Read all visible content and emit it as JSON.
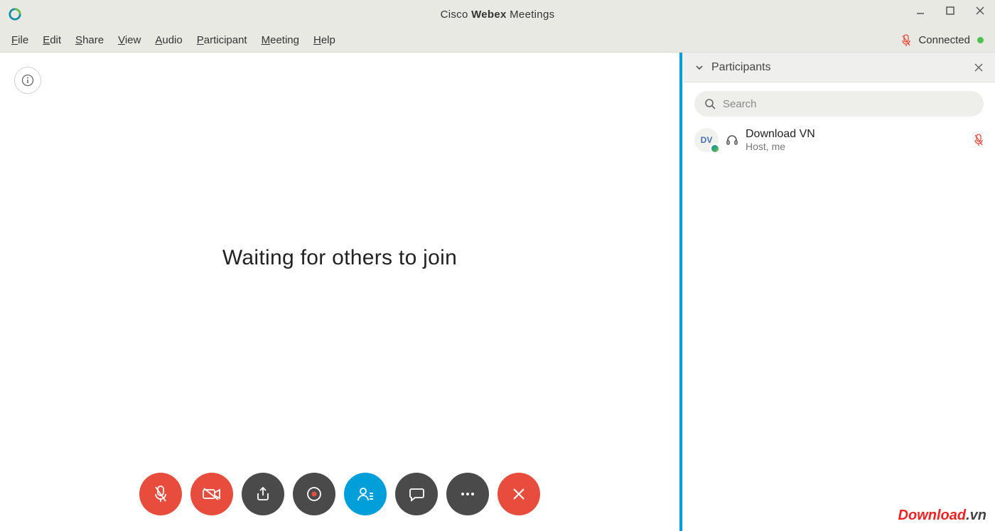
{
  "window": {
    "title_prefix": "Cisco ",
    "title_bold": "Webex",
    "title_suffix": " Meetings"
  },
  "menu": {
    "file": "File",
    "edit": "Edit",
    "share": "Share",
    "view": "View",
    "audio": "Audio",
    "participant": "Participant",
    "meeting": "Meeting",
    "help": "Help"
  },
  "status": {
    "connected_label": "Connected"
  },
  "stage": {
    "waiting_text": "Waiting for others to join"
  },
  "panel": {
    "title": "Participants",
    "search_placeholder": "Search"
  },
  "participants": [
    {
      "initials": "DV",
      "name": "Download VN",
      "role": "Host, me"
    }
  ],
  "watermark": {
    "main": "Download",
    "suffix": ".vn"
  }
}
